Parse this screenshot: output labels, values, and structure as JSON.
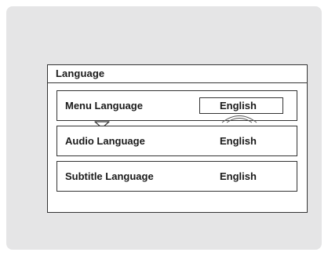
{
  "panel": {
    "title": "Language"
  },
  "rows": [
    {
      "label": "Menu Language",
      "value": "English"
    },
    {
      "label": "Audio Language",
      "value": "English"
    },
    {
      "label": "Subtitle Language",
      "value": "English"
    }
  ],
  "icons": {
    "pointer": "triangle-pointer-down-icon",
    "cursor": "selection-arc-icon"
  },
  "colors": {
    "background": "#e5e5e6",
    "panel": "#ffffff",
    "border": "#333333",
    "text": "#1a1a1a"
  }
}
